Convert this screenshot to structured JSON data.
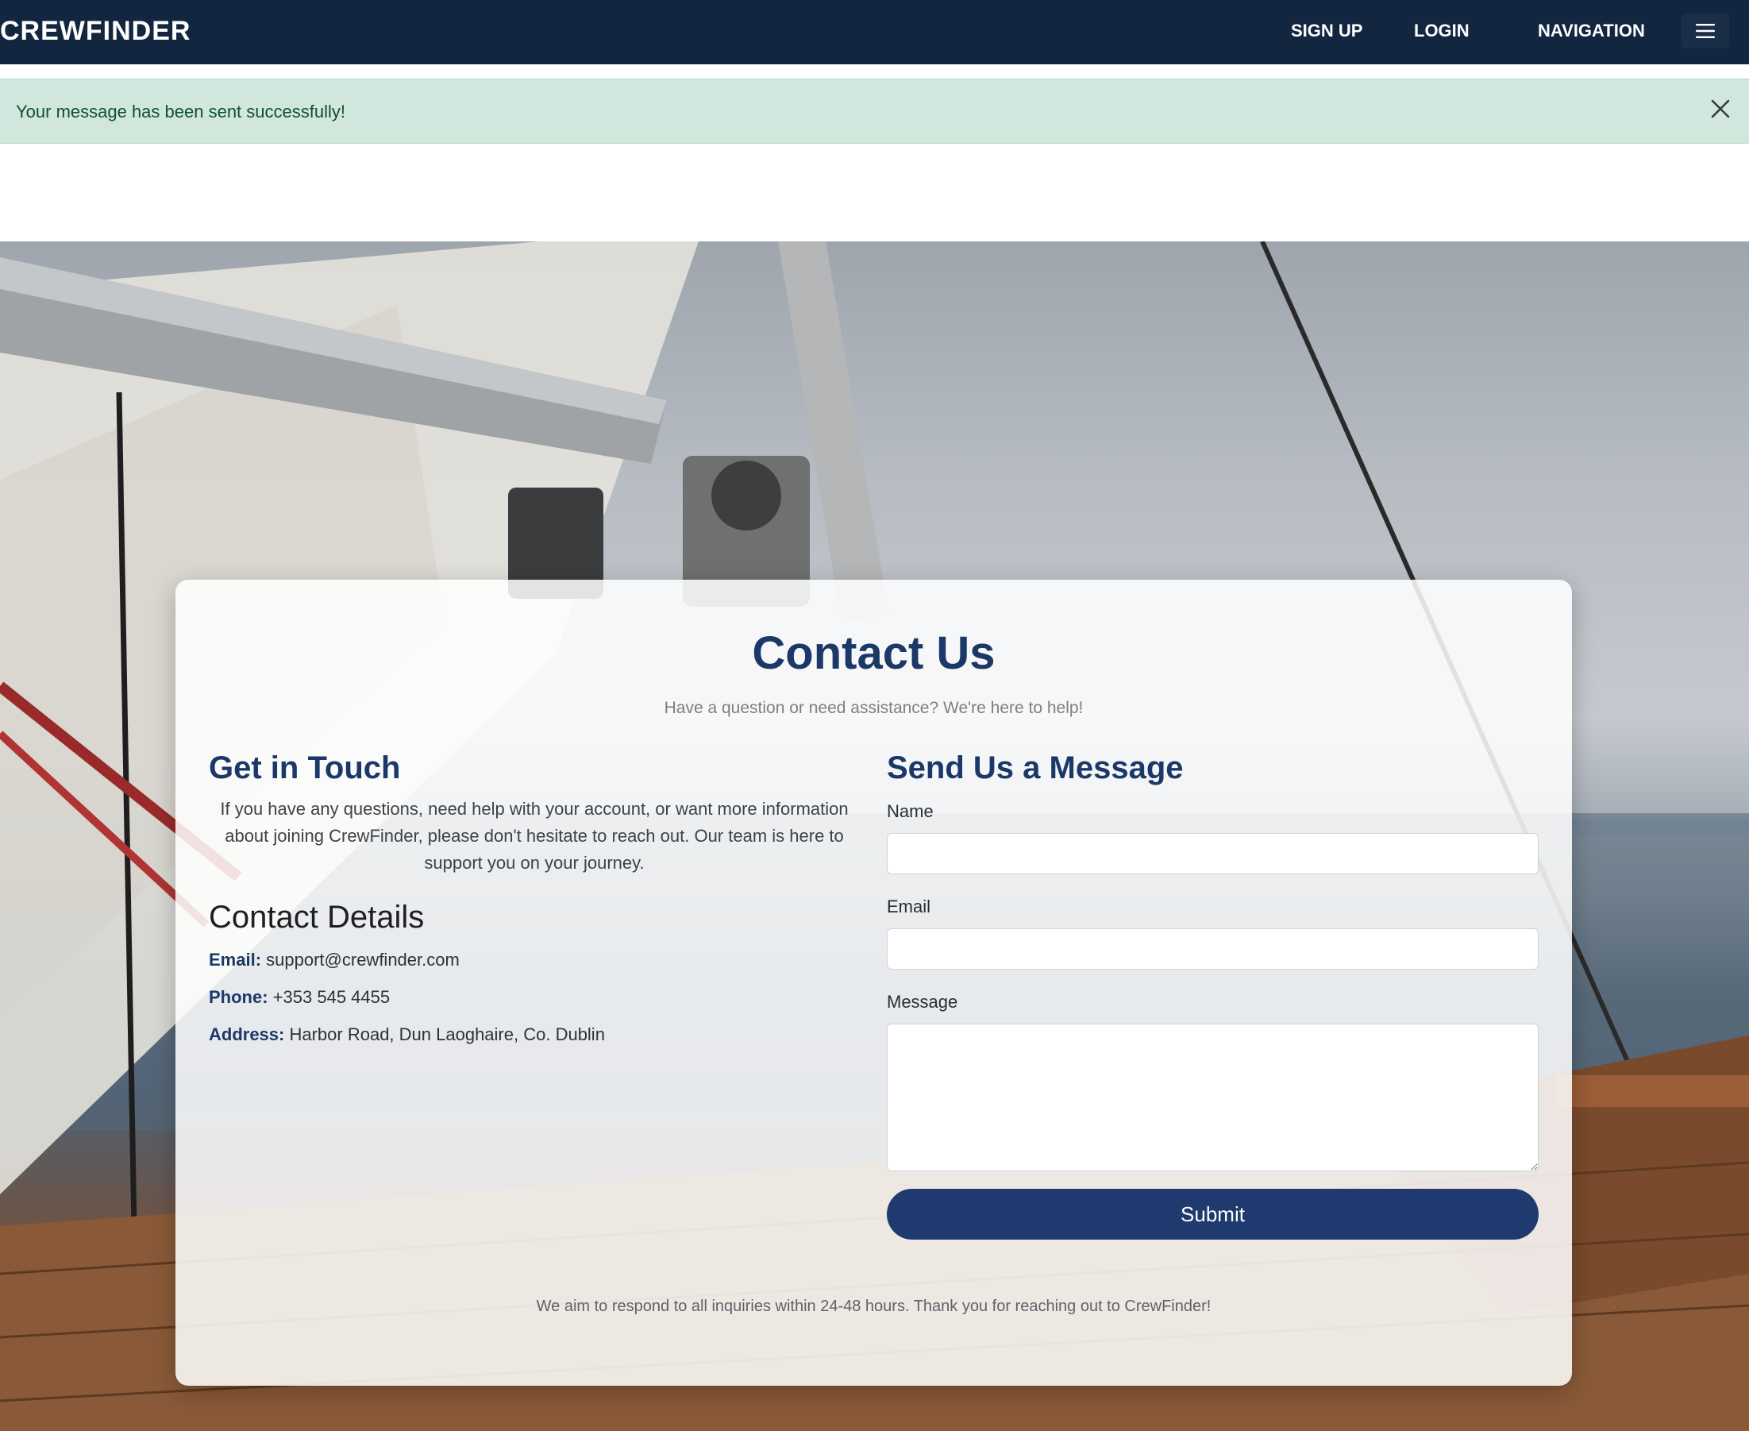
{
  "navbar": {
    "brand": "CREWFINDER",
    "sign_up": "SIGN UP",
    "login": "LOGIN",
    "navigation": "NAVIGATION",
    "menu_icon": "hamburger-menu-icon"
  },
  "alert": {
    "message": "Your message has been sent successfully!",
    "close_icon": "close-icon"
  },
  "contact": {
    "title": "Contact Us",
    "subtitle": "Have a question or need assistance? We're here to help!",
    "get_in_touch": {
      "heading": "Get in Touch",
      "text": "If you have any questions, need help with your account, or want more information about joining CrewFinder, please don't hesitate to reach out. Our team is here to support you on your journey."
    },
    "details": {
      "heading": "Contact Details",
      "email_label": "Email:",
      "email_value": "support@crewfinder.com",
      "phone_label": "Phone:",
      "phone_value": "+353 545 4455",
      "address_label": "Address:",
      "address_value": "Harbor Road, Dun Laoghaire, Co. Dublin"
    },
    "form": {
      "heading": "Send Us a Message",
      "name_label": "Name",
      "name_value": "",
      "email_label": "Email",
      "email_value": "",
      "message_label": "Message",
      "message_value": "",
      "submit_label": "Submit"
    },
    "footer_note": "We aim to respond to all inquiries within 24-48 hours. Thank you for reaching out to CrewFinder!"
  },
  "colors": {
    "navbar_bg": "#13263f",
    "accent": "#1c3868",
    "button": "#1f3a6e",
    "alert_bg": "#d1e7dd",
    "alert_text": "#0f5132"
  }
}
